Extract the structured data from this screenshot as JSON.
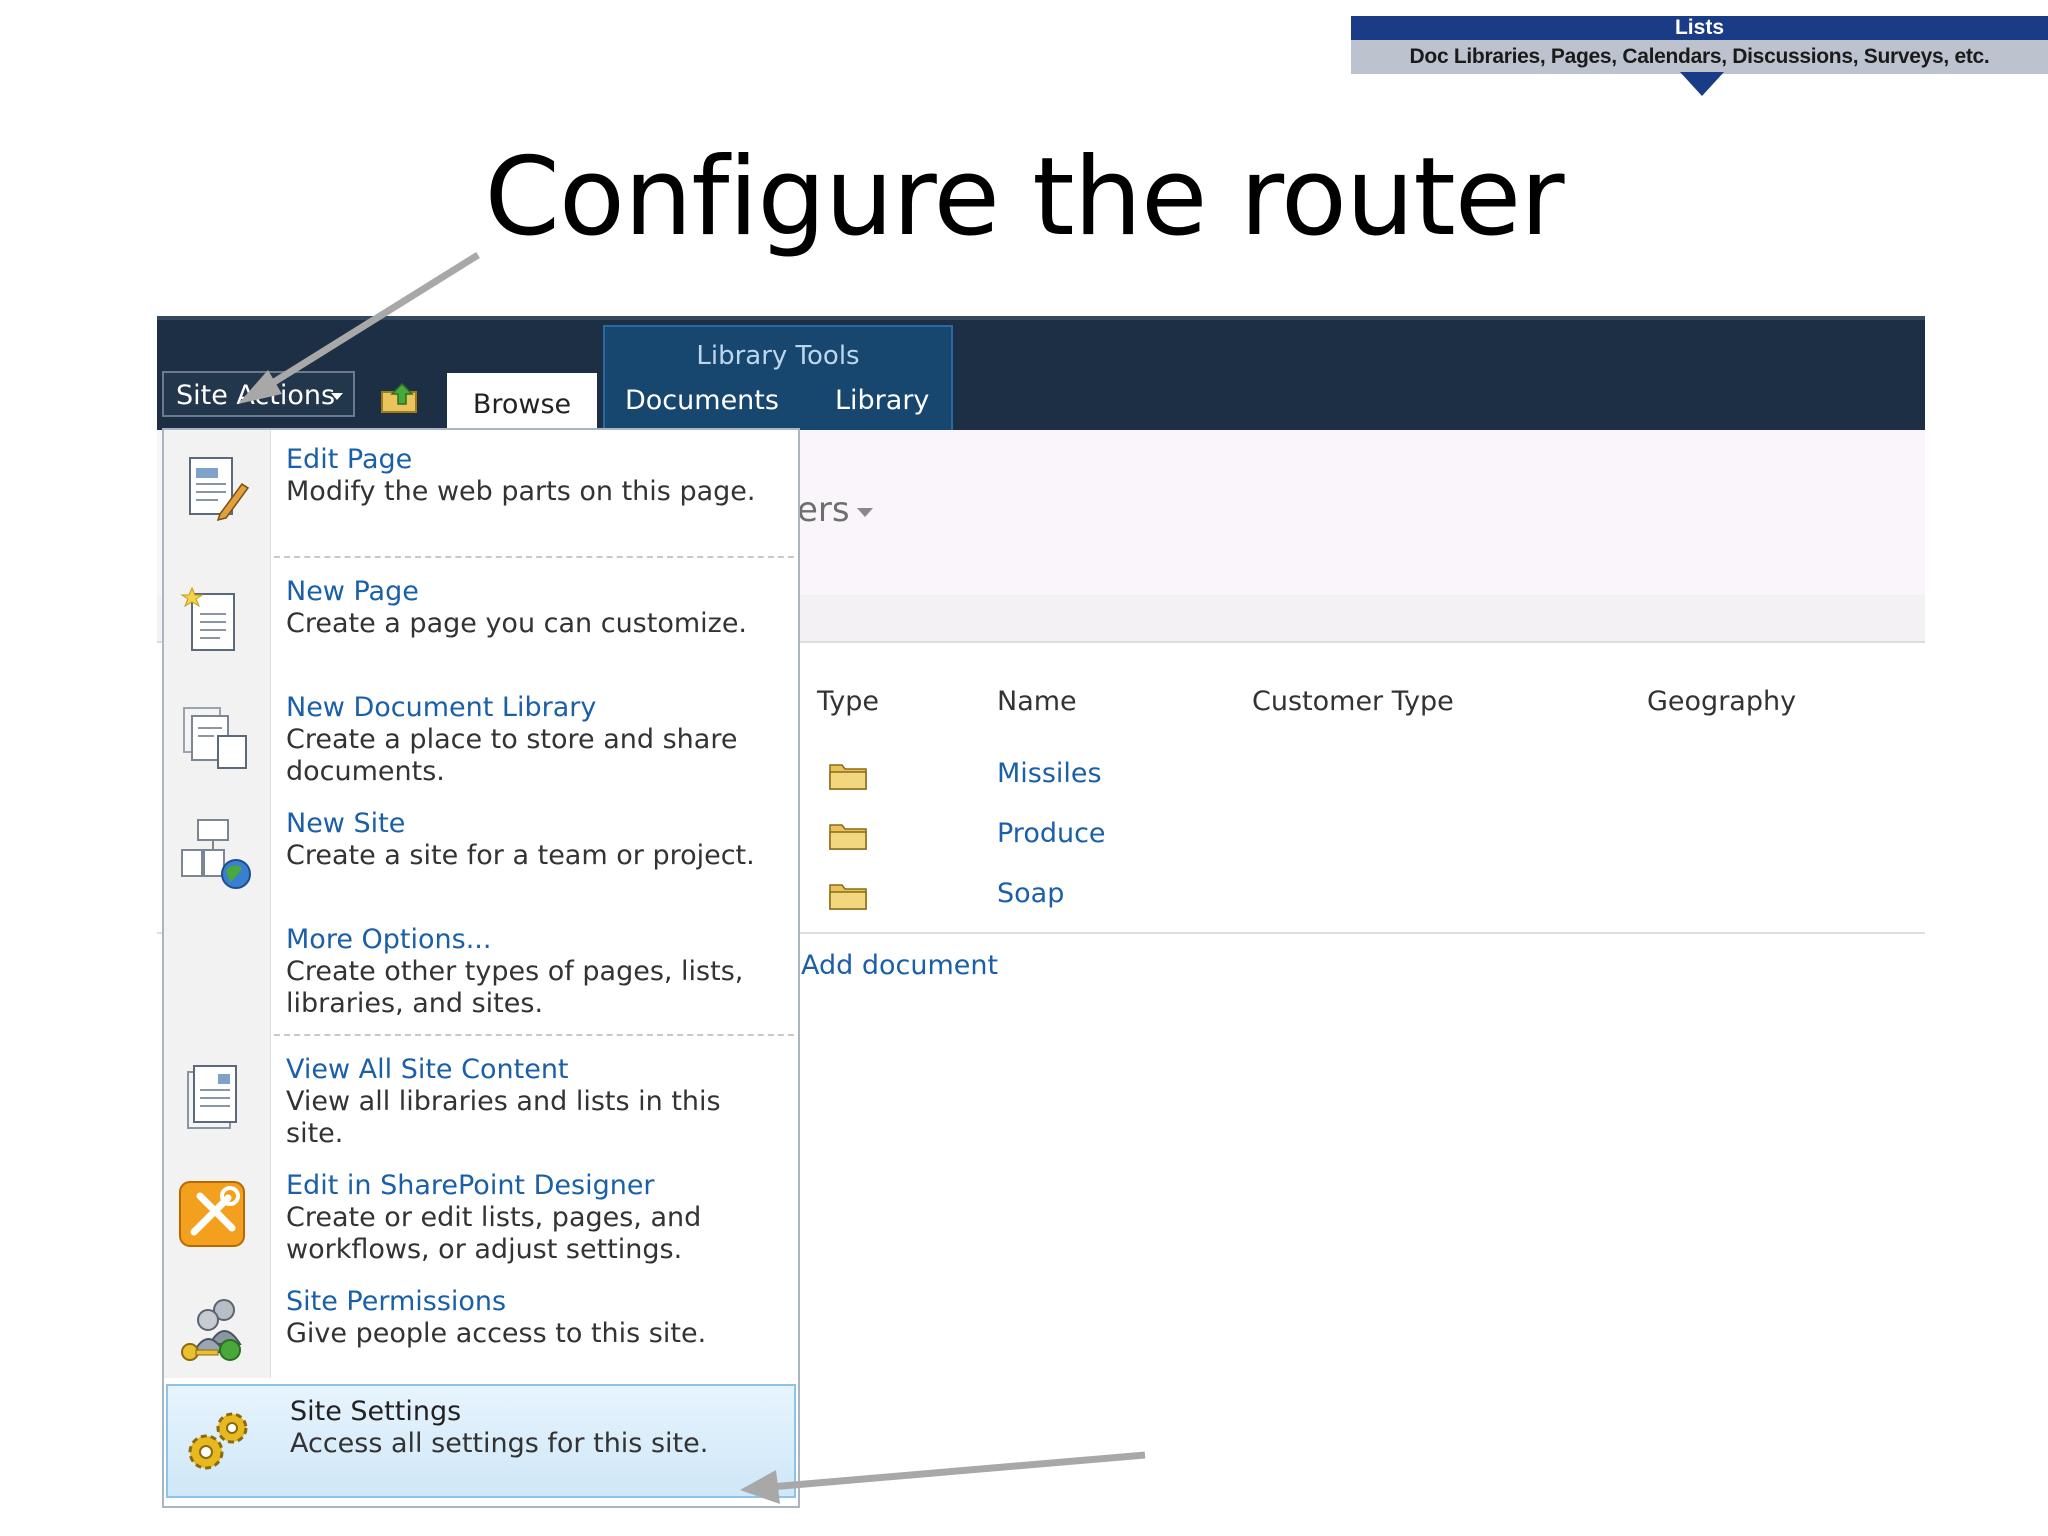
{
  "slide": {
    "title": "Configure the router",
    "legend_head": "Lists",
    "legend_sub": "Doc Libraries, Pages, Calendars, Discussions, Surveys, etc."
  },
  "ribbon": {
    "site_actions": "Site Actions",
    "tab_browse": "Browse",
    "context_group": "Library Tools",
    "tab_documents": "Documents",
    "tab_library": "Library"
  },
  "page": {
    "view_label_partial": "ers",
    "columns": [
      "Type",
      "Name",
      "Customer Type",
      "Geography"
    ],
    "items": [
      "Missiles",
      "Produce",
      "Soap"
    ],
    "add_document": "Add document"
  },
  "menu": {
    "items": [
      {
        "title": "Edit Page",
        "desc": "Modify the web parts on this page.",
        "icon": "edit-page-icon"
      },
      {
        "title": "New Page",
        "desc": "Create a page you can customize.",
        "icon": "new-page-icon"
      },
      {
        "title": "New Document Library",
        "desc": "Create a place to store and share documents.",
        "icon": "new-document-library-icon"
      },
      {
        "title": "New Site",
        "desc": "Create a site for a team or project.",
        "icon": "new-site-icon"
      },
      {
        "title": "More Options...",
        "desc": "Create other types of pages, lists, libraries, and sites.",
        "icon": ""
      },
      {
        "title": "View All Site Content",
        "desc": "View all libraries and lists in this site.",
        "icon": "view-all-content-icon"
      },
      {
        "title": "Edit in SharePoint Designer",
        "desc": "Create or edit lists, pages, and workflows, or adjust settings.",
        "icon": "sharepoint-designer-icon"
      },
      {
        "title": "Site Permissions",
        "desc": "Give people access to this site.",
        "icon": "site-permissions-icon"
      },
      {
        "title": "Site Settings",
        "desc": "Access all settings for this site.",
        "icon": "gears-icon"
      }
    ]
  },
  "colors": {
    "ribbon": "#1d2f44",
    "link": "#1a5fa8",
    "legend": "#1a3b86",
    "highlight": "#cfe7f8"
  }
}
